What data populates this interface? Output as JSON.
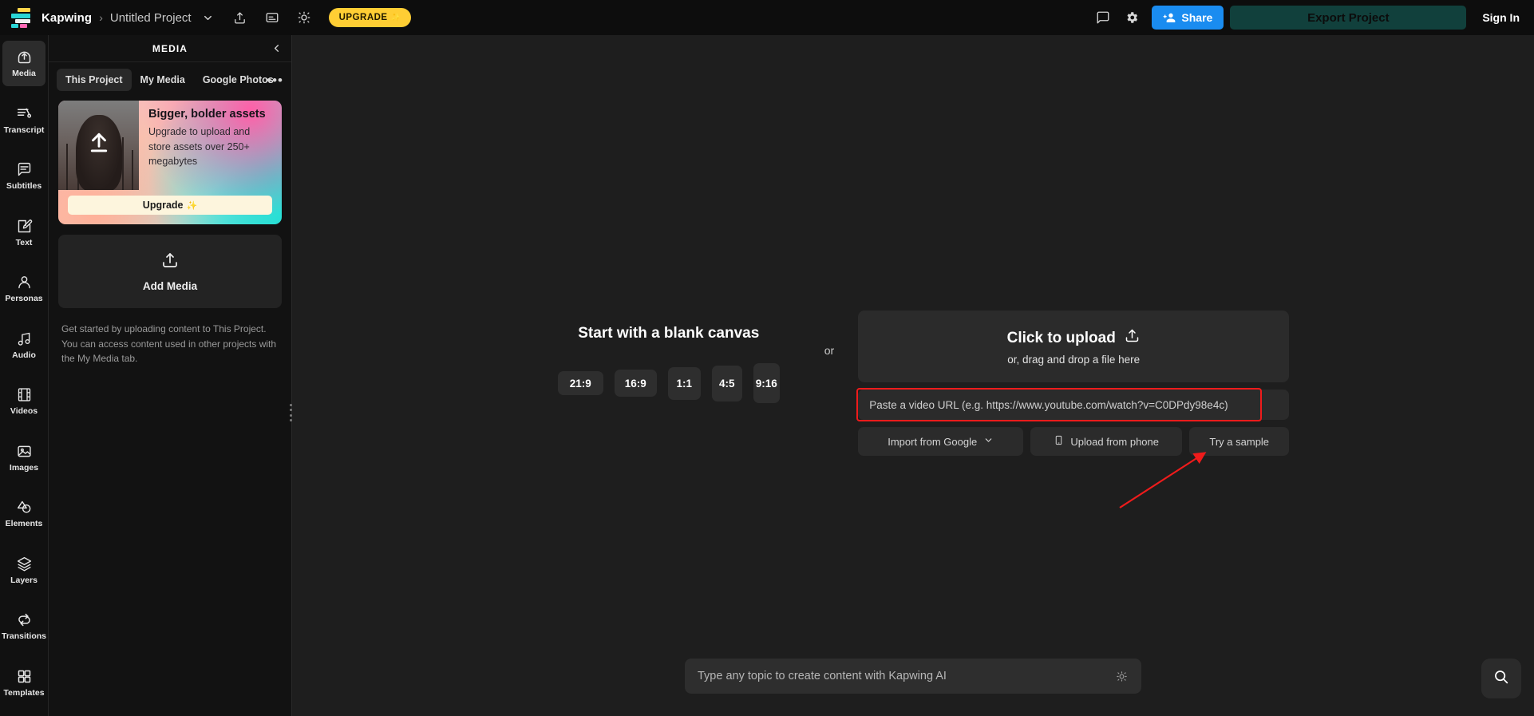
{
  "topbar": {
    "logo_name": "kapwing-logo",
    "brand": "Kapwing",
    "separator": "›",
    "project_name": "Untitled Project",
    "project_dropdown_icon": "chevron-down-icon",
    "share_icon": "share-upload-icon",
    "captions_icon": "captions-icon",
    "idea_icon": "lightbulb-icon",
    "upgrade_label": "UPGRADE",
    "upgrade_sparkle": "✨",
    "comment_icon": "comment-icon",
    "settings_icon": "gear-icon",
    "share_label": "Share",
    "export_label": "Export Project",
    "signin_label": "Sign In",
    "accent_blue": "#1a8cf0",
    "accent_yellow": "#ffce34",
    "export_bg": "#11403c"
  },
  "rail": {
    "items": [
      {
        "label": "Media",
        "icon": "media-upload-icon",
        "active": true
      },
      {
        "label": "Transcript",
        "icon": "transcript-icon",
        "active": false
      },
      {
        "label": "Subtitles",
        "icon": "subtitles-icon",
        "active": false
      },
      {
        "label": "Text",
        "icon": "text-edit-icon",
        "active": false
      },
      {
        "label": "Personas",
        "icon": "person-icon",
        "active": false
      },
      {
        "label": "Audio",
        "icon": "music-note-icon",
        "active": false
      },
      {
        "label": "Videos",
        "icon": "film-strip-icon",
        "active": false
      },
      {
        "label": "Images",
        "icon": "image-icon",
        "active": false
      },
      {
        "label": "Elements",
        "icon": "shapes-icon",
        "active": false
      },
      {
        "label": "Layers",
        "icon": "layers-icon",
        "active": false
      },
      {
        "label": "Transitions",
        "icon": "transitions-icon",
        "active": false
      },
      {
        "label": "Templates",
        "icon": "grid-templates-icon",
        "active": false
      }
    ]
  },
  "panel": {
    "title": "MEDIA",
    "collapse_icon": "chevron-left-icon",
    "overflow_icon": "more-options-icon",
    "overflow_label": "•••",
    "tabs": [
      {
        "label": "This Project",
        "active": true
      },
      {
        "label": "My Media",
        "active": false
      },
      {
        "label": "Google Photos",
        "active": false
      }
    ],
    "promo": {
      "title": "Bigger, bolder assets",
      "subtitle": "Upgrade to upload and store assets over 250+ megabytes",
      "button_label": "Upgrade",
      "button_sparkle": "✨",
      "thumb_icon": "upload-arrow-icon"
    },
    "add_media": {
      "label": "Add Media",
      "icon": "upload-icon"
    },
    "hint": "Get started by uploading content to This Project. You can access content used in other projects with the My Media tab.",
    "resize_handle": "panel-resize-grip"
  },
  "canvas": {
    "blank": {
      "title": "Start with a blank canvas",
      "ratios": [
        {
          "label": "21:9",
          "key": "r-219"
        },
        {
          "label": "16:9",
          "key": "r-169"
        },
        {
          "label": "1:1",
          "key": "r-11"
        },
        {
          "label": "4:5",
          "key": "r-45"
        },
        {
          "label": "9:16",
          "key": "r-916"
        }
      ]
    },
    "or_label": "or",
    "upload": {
      "main_label": "Click to upload",
      "main_icon": "upload-icon",
      "sub_label": "or, drag and drop a file here"
    },
    "url_field": {
      "value": "",
      "placeholder": "Paste a video URL (e.g. https://www.youtube.com/watch?v=C0DPdy98e4c)",
      "highlight_color": "#ef1b1b"
    },
    "actions": [
      {
        "label": "Import from Google",
        "icon": "chevron-down-icon",
        "key": "b-google"
      },
      {
        "label": "Upload from phone",
        "icon": "phone-icon",
        "key": "b-phone"
      },
      {
        "label": "Try a sample",
        "icon": "",
        "key": "b-sample"
      }
    ],
    "annotation": {
      "type": "red-arrow",
      "color": "#ef1b1b"
    }
  },
  "bottom": {
    "ai_placeholder": "Type any topic to create content with Kapwing AI",
    "ai_value": "",
    "ai_icon": "lightbulb-icon",
    "search_icon": "search-icon"
  }
}
